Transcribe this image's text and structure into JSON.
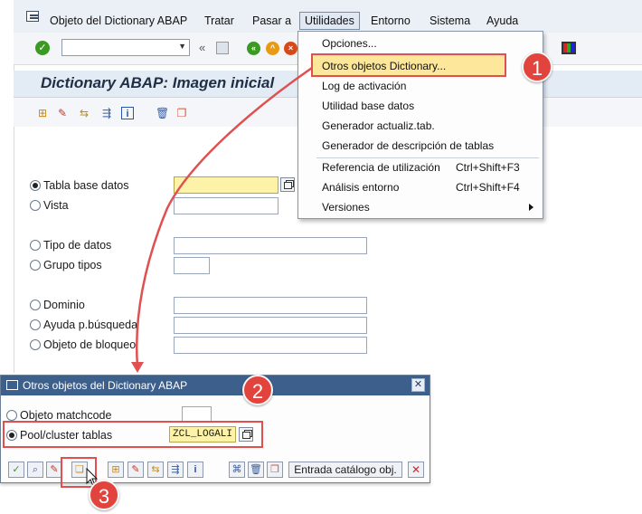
{
  "menubar": {
    "items": [
      "Objeto del Dictionary ABAP",
      "Tratar",
      "Pasar a",
      "Utilidades",
      "Entorno",
      "Sistema",
      "Ayuda"
    ]
  },
  "main": {
    "title": "Dictionary ABAP: Imagen inicial",
    "options": [
      {
        "label": "Tabla base datos",
        "selected": true
      },
      {
        "label": "Vista",
        "selected": false
      },
      {
        "label": "Tipo de datos",
        "selected": false
      },
      {
        "label": "Grupo tipos",
        "selected": false
      },
      {
        "label": "Dominio",
        "selected": false
      },
      {
        "label": "Ayuda p.búsqueda",
        "selected": false
      },
      {
        "label": "Objeto de bloqueo",
        "selected": false
      }
    ]
  },
  "utilidades_menu": {
    "items": [
      {
        "label": "Opciones...",
        "shortcut": ""
      },
      {
        "label": "Otros objetos Dictionary...",
        "shortcut": ""
      },
      {
        "label": "Log de activación",
        "shortcut": ""
      },
      {
        "label": "Utilidad base datos",
        "shortcut": ""
      },
      {
        "label": "Generador actualiz.tab.",
        "shortcut": ""
      },
      {
        "label": "Generador de descripción de tablas",
        "shortcut": ""
      },
      {
        "label": "Referencia de utilización",
        "shortcut": "Ctrl+Shift+F3"
      },
      {
        "label": "Análisis entorno",
        "shortcut": "Ctrl+Shift+F4"
      },
      {
        "label": "Versiones",
        "shortcut": ""
      }
    ]
  },
  "popup": {
    "title": "Otros objetos del Dictionary ABAP",
    "options": [
      {
        "label": "Objeto matchcode",
        "selected": false,
        "value": ""
      },
      {
        "label": "Pool/cluster tablas",
        "selected": true,
        "value": "ZCL_LOGALI"
      }
    ],
    "catalog_button": "Entrada catálogo obj."
  },
  "steps": [
    "1",
    "2",
    "3"
  ],
  "colors": {
    "highlight_red": "#e05050",
    "step_badge": "#e2433c",
    "popup_titlebar": "#3d5f8c",
    "selected_menu": "#fde79a",
    "required_field": "#fdf3a8"
  },
  "icons": [
    "system-menu-icon",
    "enter-icon",
    "back-icon",
    "save-icon",
    "exit-icon",
    "cancel-icon",
    "customize-layout-icon",
    "create-icon",
    "display-icon",
    "change-icon",
    "copy-icon",
    "delete-icon",
    "where-used-icon",
    "info-icon",
    "find-icon",
    "close-icon",
    "cursor-icon"
  ]
}
